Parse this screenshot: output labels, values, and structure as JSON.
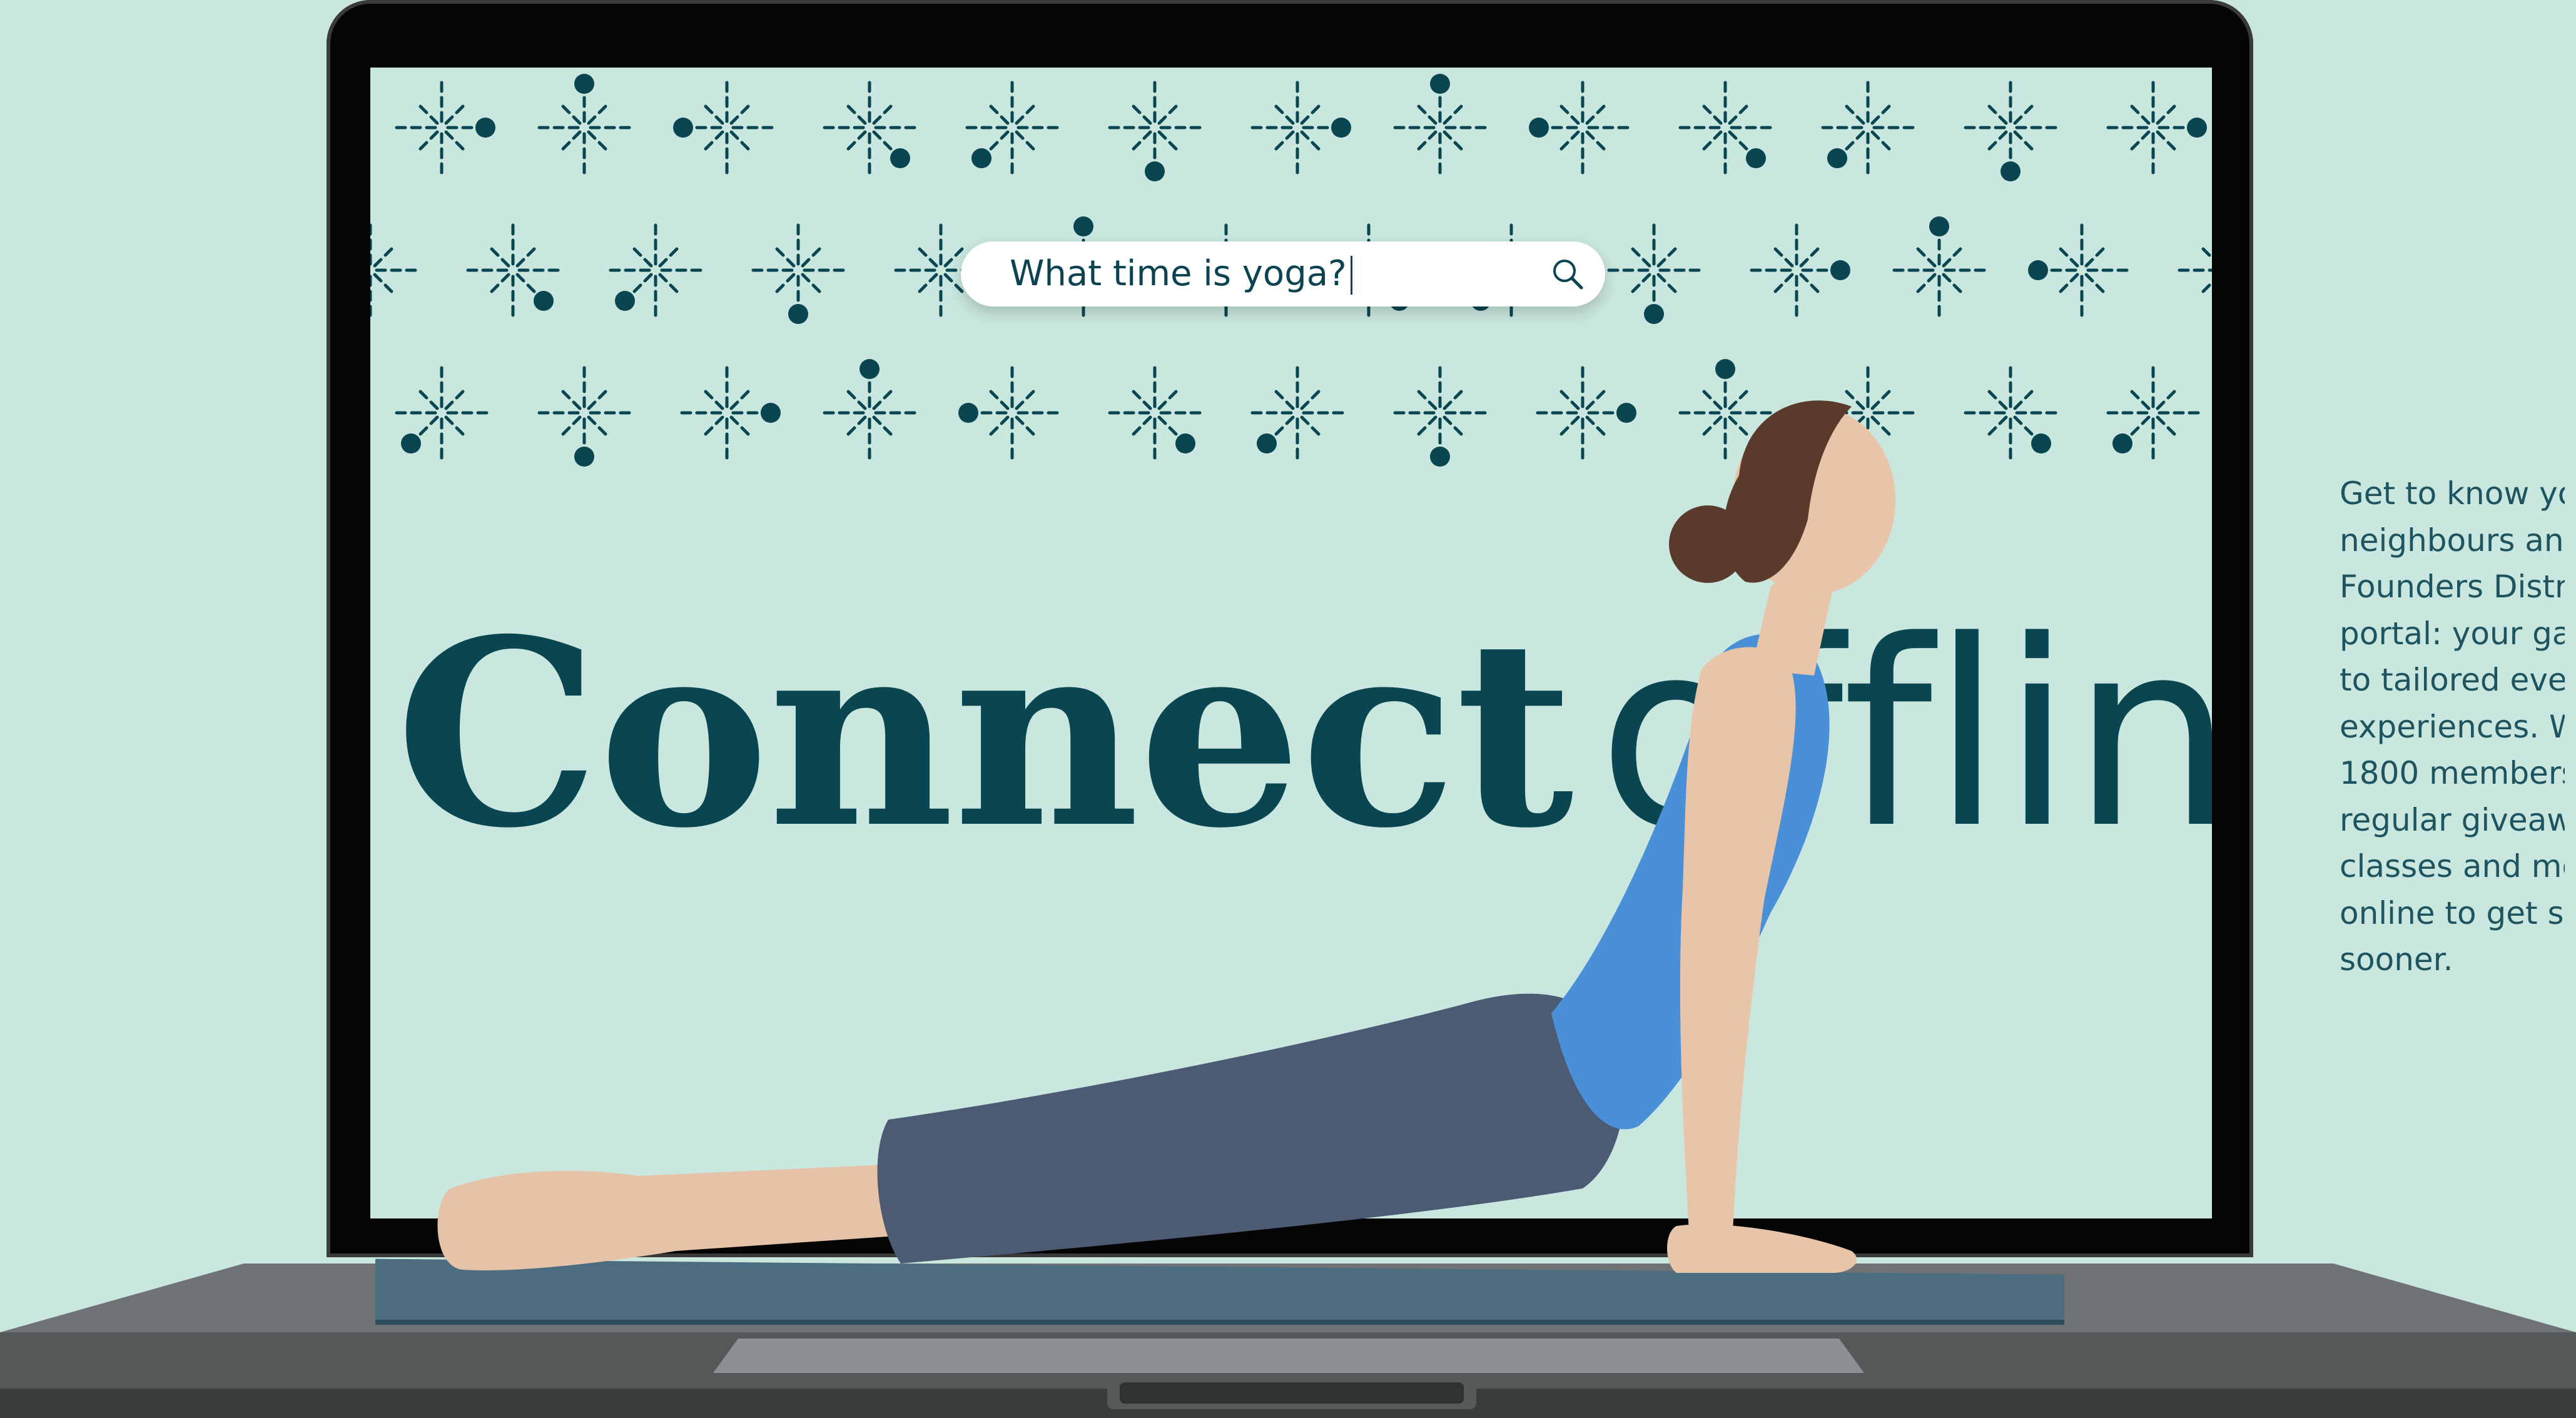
{
  "search": {
    "query": "What time is yoga?"
  },
  "headline": {
    "word1": "Connect",
    "word2": "offline"
  },
  "side_text": {
    "lines": [
      "Get to know you",
      "neighbours and",
      "Founders Distric",
      "portal: your gate",
      "to tailored even",
      "experiences. Wi",
      "1800 members",
      "regular giveawa",
      "classes and mor",
      "online to get soc",
      "sooner."
    ]
  },
  "colors": {
    "background": "#c9e7df",
    "brand_teal": "#0a4651",
    "top_blue": "#4a90d9",
    "leggings": "#4d5a73"
  },
  "icons": {
    "search": "search-icon",
    "pattern_glyph": "sparkle-icon"
  }
}
